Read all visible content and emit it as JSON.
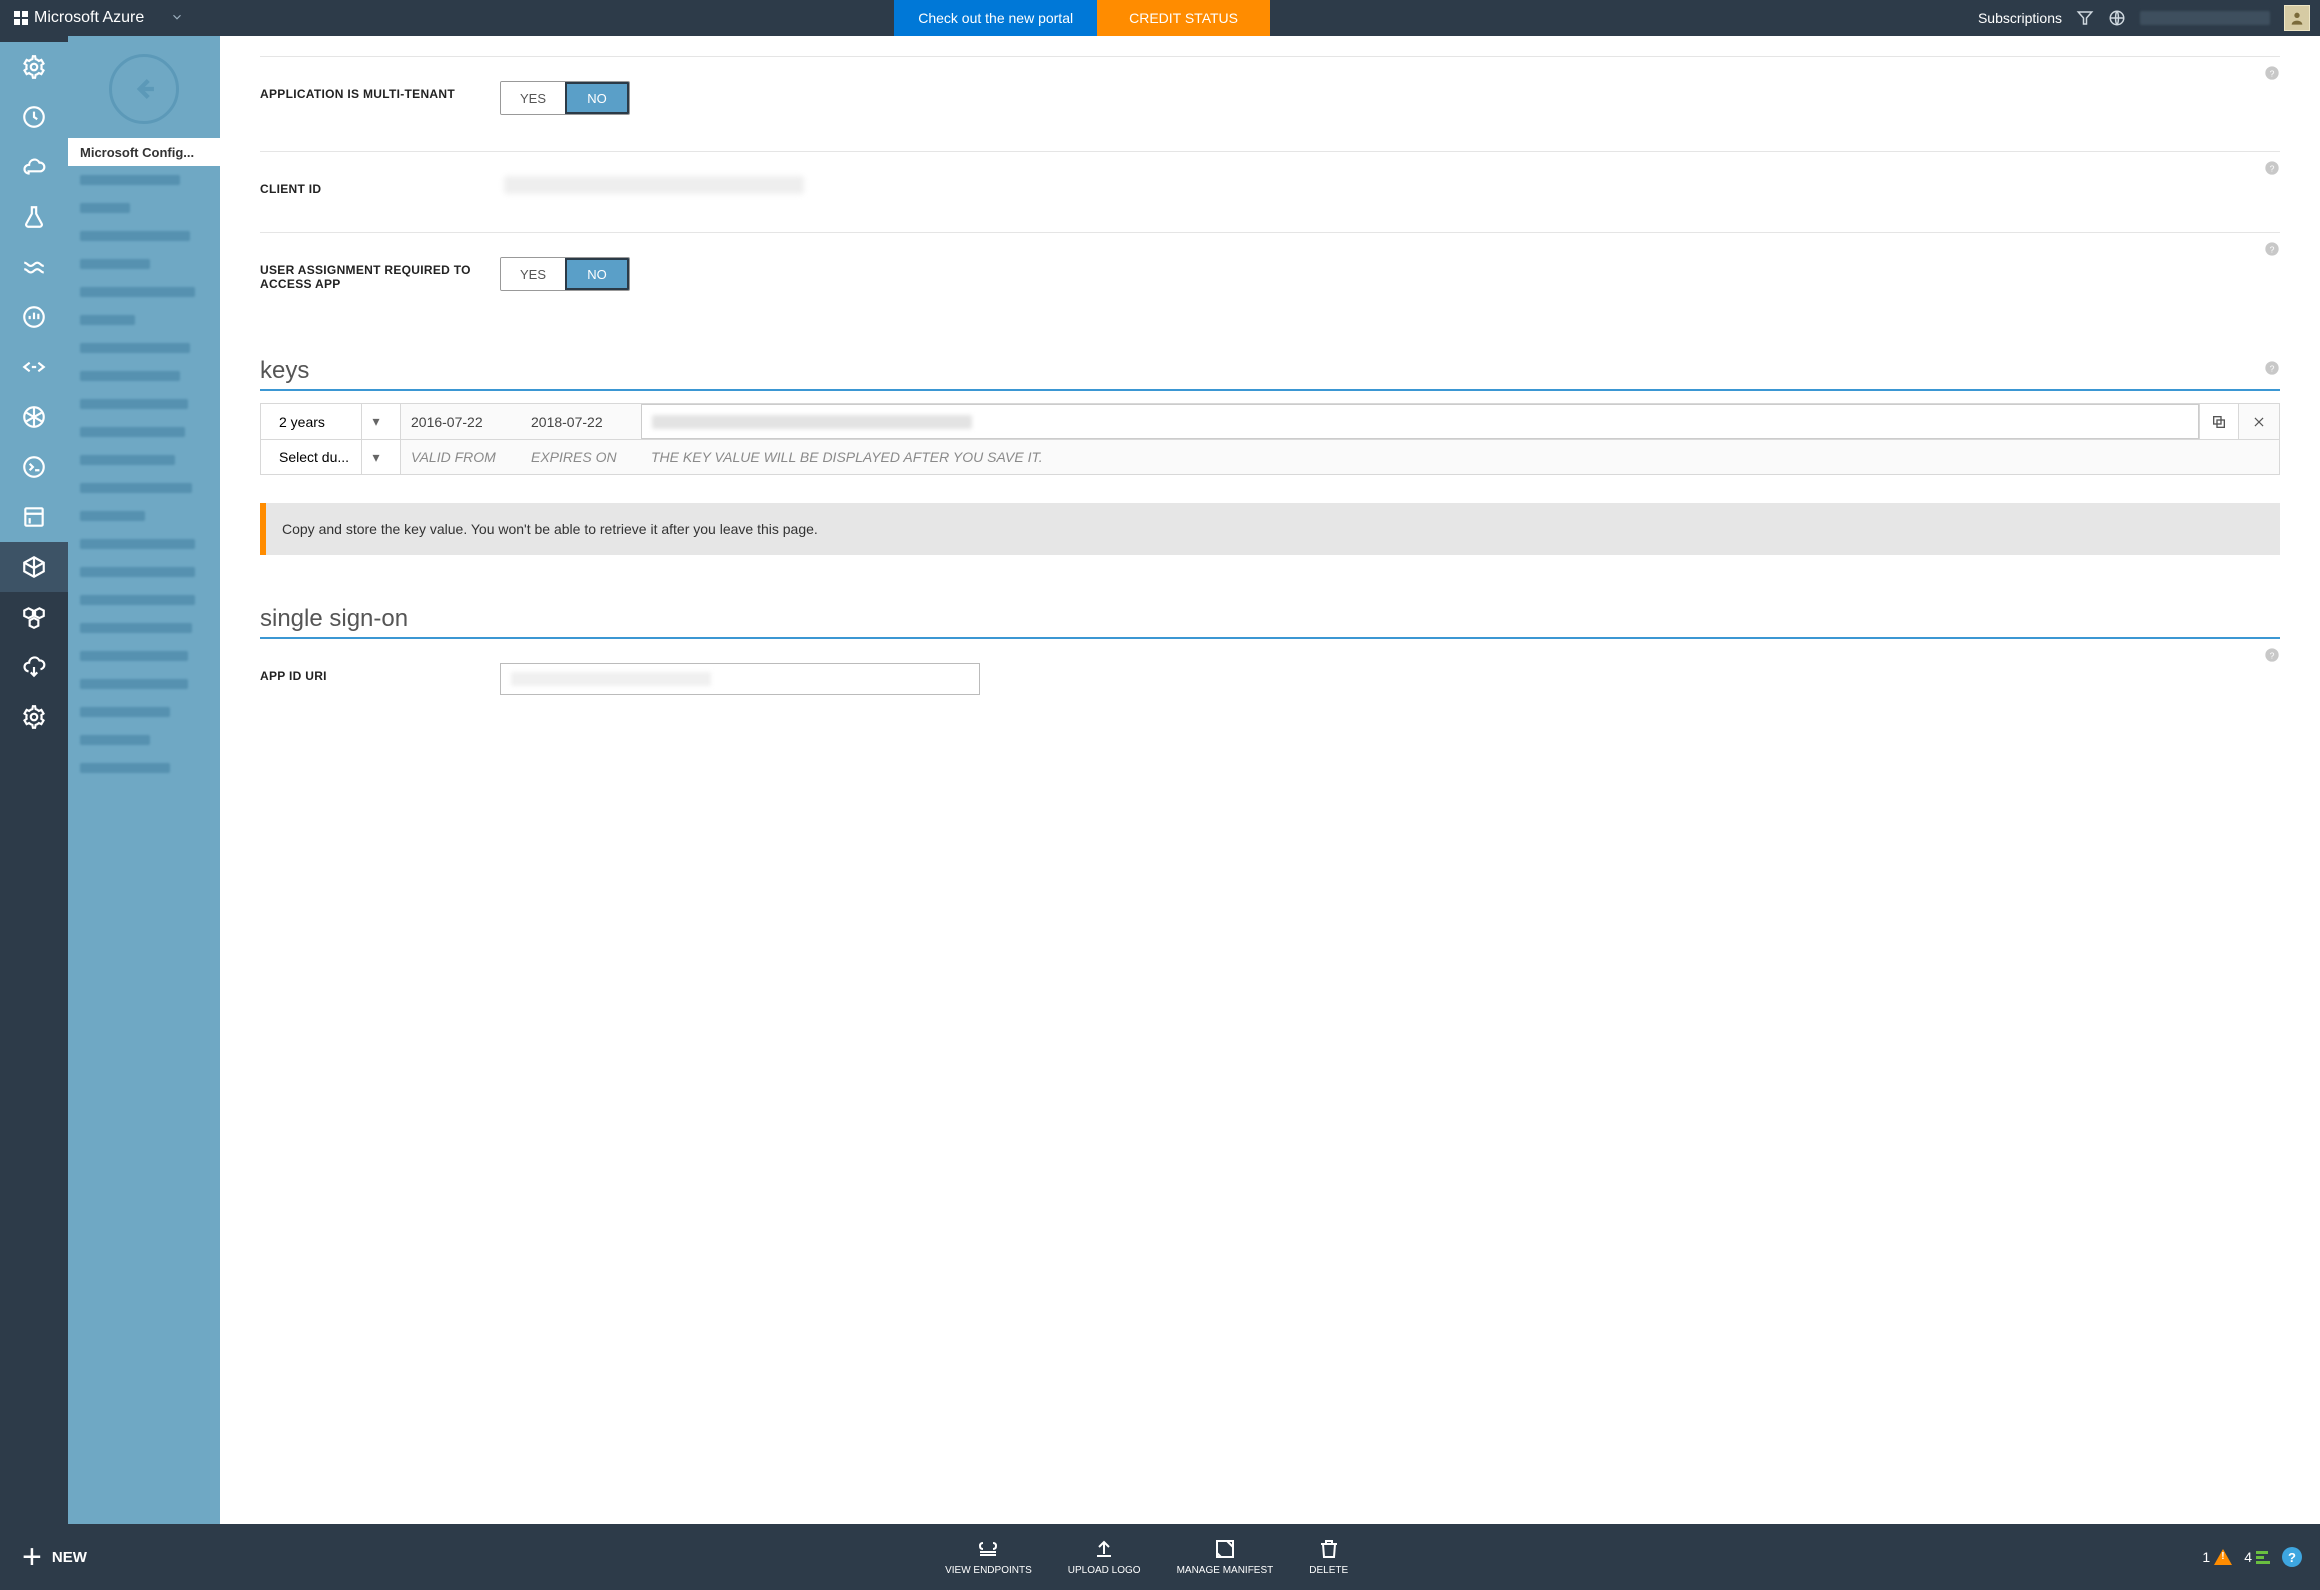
{
  "topbar": {
    "brand": "Microsoft Azure",
    "portal_link": "Check out the new portal",
    "credit_status": "CREDIT STATUS",
    "subscriptions": "Subscriptions"
  },
  "sidepanel": {
    "selected": "Microsoft Config..."
  },
  "fields": {
    "multi_tenant_label": "APPLICATION IS MULTI-TENANT",
    "yes": "YES",
    "no": "NO",
    "client_id_label": "CLIENT ID",
    "user_assign_label": "USER ASSIGNMENT REQUIRED TO ACCESS APP"
  },
  "sections": {
    "keys": "keys",
    "sso": "single sign-on"
  },
  "keys": {
    "row1": {
      "duration": "2 years",
      "from": "2016-07-22",
      "to": "2018-07-22"
    },
    "row2": {
      "duration": "Select du...",
      "from": "VALID FROM",
      "to": "EXPIRES ON",
      "value_msg": "THE KEY VALUE WILL BE DISPLAYED AFTER YOU SAVE IT."
    }
  },
  "warning": "Copy and store the key value. You won't be able to retrieve it after you leave this page.",
  "sso": {
    "app_id_uri_label": "APP ID URI"
  },
  "bottombar": {
    "new": "NEW",
    "view_endpoints": "VIEW ENDPOINTS",
    "upload_logo": "UPLOAD LOGO",
    "manage_manifest": "MANAGE MANIFEST",
    "delete": "DELETE",
    "warn_count": "1",
    "ok_count": "4"
  }
}
